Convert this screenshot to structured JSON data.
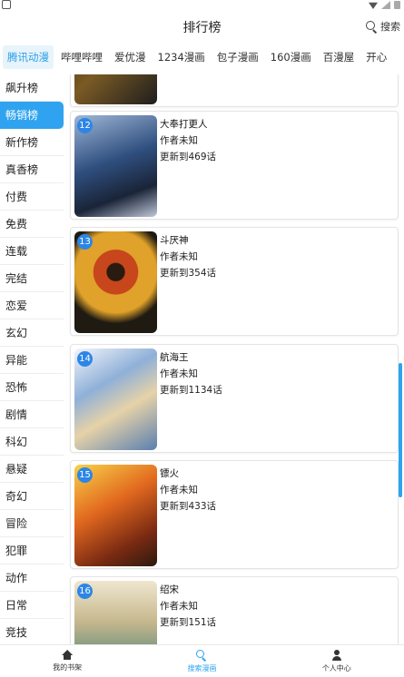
{
  "header": {
    "title": "排行榜",
    "search_label": "搜索"
  },
  "sources": [
    {
      "label": "腾讯动漫",
      "active": true
    },
    {
      "label": "哔哩哔哩",
      "active": false
    },
    {
      "label": "爱优漫",
      "active": false
    },
    {
      "label": "1234漫画",
      "active": false
    },
    {
      "label": "包子漫画",
      "active": false
    },
    {
      "label": "160漫画",
      "active": false
    },
    {
      "label": "百漫屋",
      "active": false
    },
    {
      "label": "开心",
      "active": false
    }
  ],
  "categories": [
    {
      "label": "飙升榜",
      "active": false
    },
    {
      "label": "畅销榜",
      "active": true
    },
    {
      "label": "新作榜",
      "active": false
    },
    {
      "label": "真香榜",
      "active": false
    },
    {
      "label": "付费",
      "active": false
    },
    {
      "label": "免费",
      "active": false
    },
    {
      "label": "连载",
      "active": false
    },
    {
      "label": "完结",
      "active": false
    },
    {
      "label": "恋爱",
      "active": false
    },
    {
      "label": "玄幻",
      "active": false
    },
    {
      "label": "异能",
      "active": false
    },
    {
      "label": "恐怖",
      "active": false
    },
    {
      "label": "剧情",
      "active": false
    },
    {
      "label": "科幻",
      "active": false
    },
    {
      "label": "悬疑",
      "active": false
    },
    {
      "label": "奇幻",
      "active": false
    },
    {
      "label": "冒险",
      "active": false
    },
    {
      "label": "犯罪",
      "active": false
    },
    {
      "label": "动作",
      "active": false
    },
    {
      "label": "日常",
      "active": false
    },
    {
      "label": "竞技",
      "active": false
    }
  ],
  "comics": [
    {
      "rank": "",
      "title": "",
      "author": "",
      "update": ""
    },
    {
      "rank": "12",
      "title": "大奉打更人",
      "author": "作者未知",
      "update": "更新到469话"
    },
    {
      "rank": "13",
      "title": "斗厌神",
      "author": "作者未知",
      "update": "更新到354话"
    },
    {
      "rank": "14",
      "title": "航海王",
      "author": "作者未知",
      "update": "更新到1134话"
    },
    {
      "rank": "15",
      "title": "镖火",
      "author": "作者未知",
      "update": "更新到433话"
    },
    {
      "rank": "16",
      "title": "绍宋",
      "author": "作者未知",
      "update": "更新到151话"
    }
  ],
  "bottom_nav": [
    {
      "label": "我的书架",
      "icon": "home-icon",
      "active": false
    },
    {
      "label": "搜索漫画",
      "icon": "search-icon",
      "active": true
    },
    {
      "label": "个人中心",
      "icon": "person-icon",
      "active": false
    }
  ],
  "colors": {
    "accent": "#2fa3ef",
    "rank_badge": "#2d86e6"
  }
}
